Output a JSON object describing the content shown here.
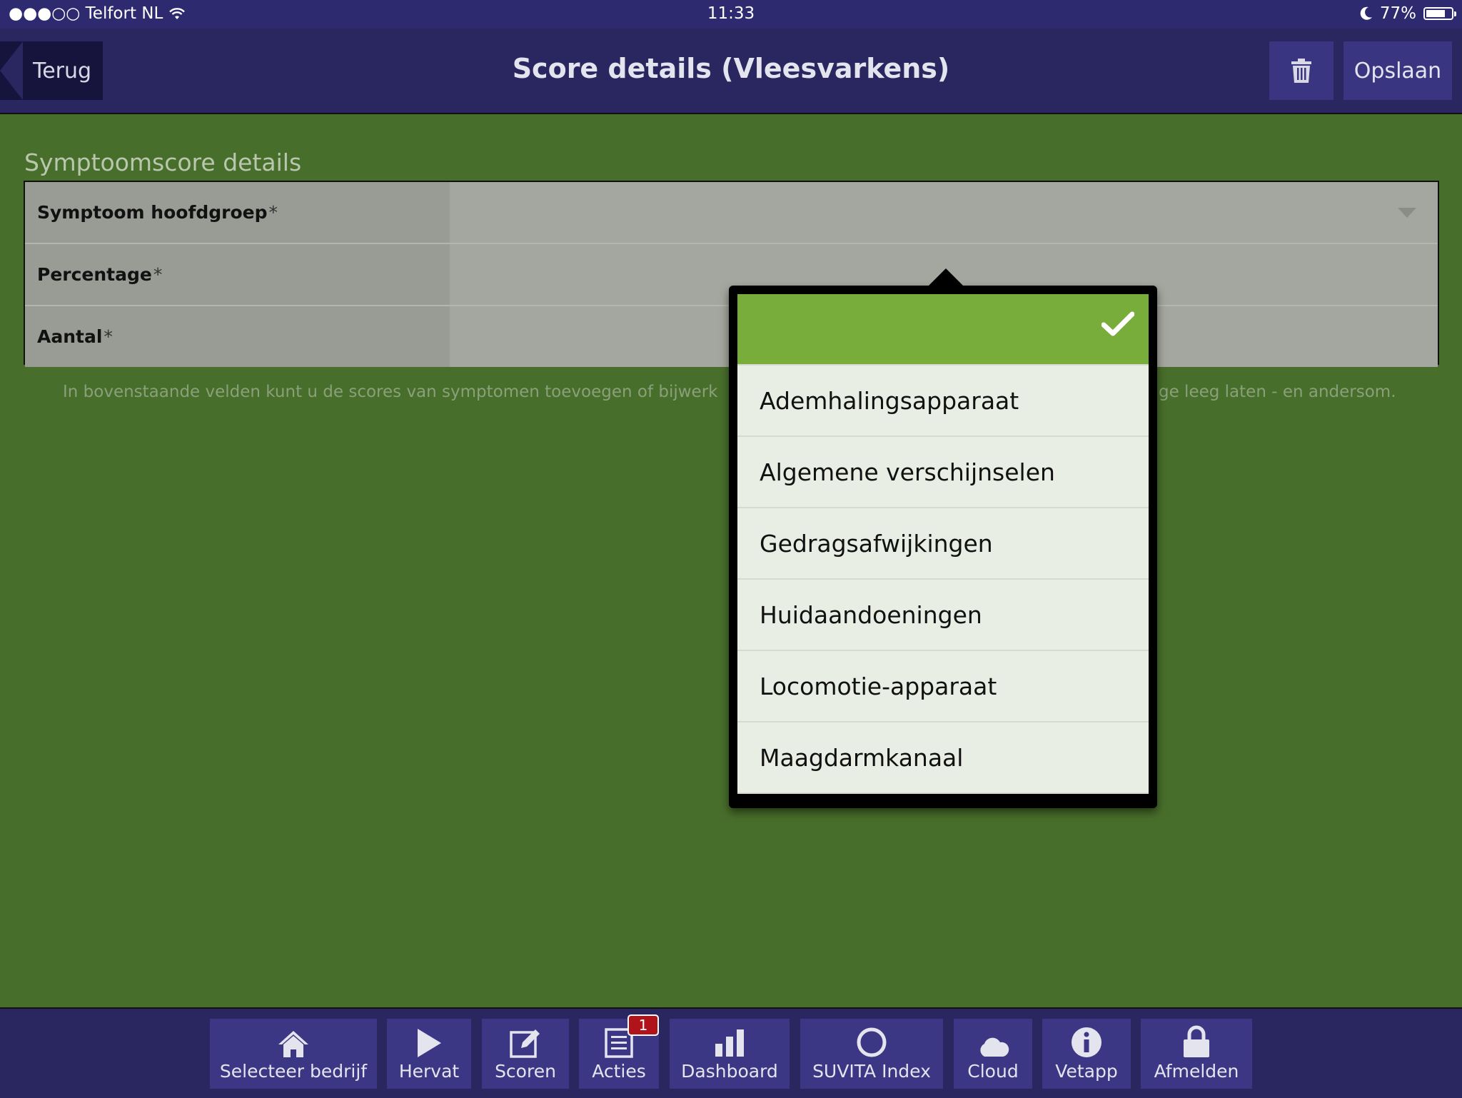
{
  "status_bar": {
    "carrier": "●●●○○ Telfort NL",
    "time": "11:33",
    "battery": "77%",
    "battery_level": 0.77
  },
  "nav": {
    "back_label": "Terug",
    "title": "Score details (Vleesvarkens)",
    "save_label": "Opslaan",
    "trash_icon": "trash-icon"
  },
  "form": {
    "section_title": "Symptoomscore details",
    "fields": [
      {
        "label": "Symptoom hoofdgroep",
        "required": "*",
        "value": ""
      },
      {
        "label": "Percentage",
        "required": "*",
        "value": ""
      },
      {
        "label": "Aantal",
        "required": "*",
        "value": ""
      }
    ],
    "hint_left": "In bovenstaande velden kunt u de scores van symptomen toevoegen of bijwerk",
    "hint_right": "ge leeg laten - en andersom."
  },
  "dropdown": {
    "selected_icon": "checkmark-icon",
    "options": [
      "Ademhalingsapparaat",
      "Algemene verschijnselen",
      "Gedragsafwijkingen",
      "Huidaandoeningen",
      "Locomotie-apparaat",
      "Maagdarmkanaal"
    ]
  },
  "tabbar": {
    "tabs": [
      {
        "label": "Selecteer bedrijf",
        "icon": "home-icon"
      },
      {
        "label": "Hervat",
        "icon": "play-icon"
      },
      {
        "label": "Scoren",
        "icon": "edit-icon"
      },
      {
        "label": "Acties",
        "icon": "list-icon",
        "badge": "1"
      },
      {
        "label": "Dashboard",
        "icon": "bar-chart-icon"
      },
      {
        "label": "SUVITA Index",
        "icon": "circle-icon"
      },
      {
        "label": "Cloud",
        "icon": "cloud-icon"
      },
      {
        "label": "Vetapp",
        "icon": "info-icon"
      },
      {
        "label": "Afmelden",
        "icon": "lock-icon"
      }
    ]
  },
  "colors": {
    "background": "#486e2b",
    "navbar": "#292660",
    "accent_green": "#78ac3b",
    "badge_red": "#b0141a"
  }
}
